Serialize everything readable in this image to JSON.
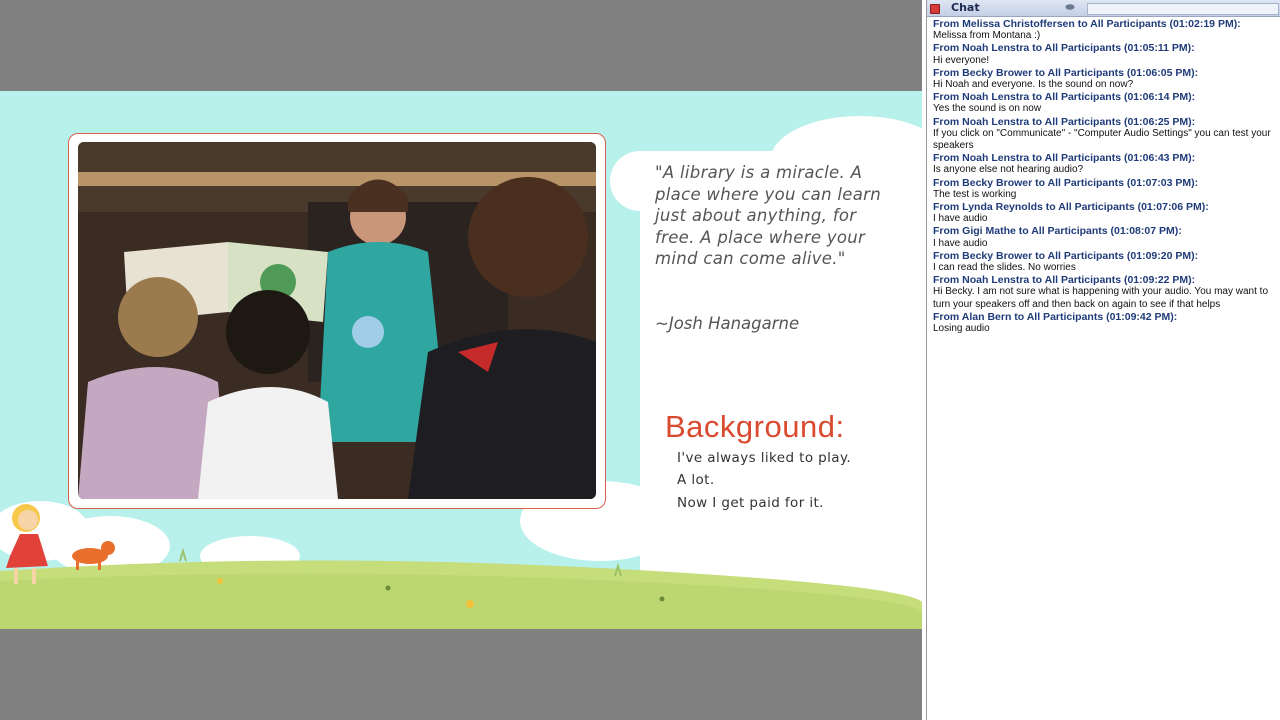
{
  "slide": {
    "quote": "\"A library is a miracle. A place where you can learn just about anything, for free. A place where your mind can come alive.\"",
    "quote_author": "~Josh Hanagarne",
    "background_heading": "Background:",
    "background_lines": [
      "I've always liked to play.",
      "A lot.",
      "Now I get paid for it."
    ]
  },
  "chat": {
    "title": "Chat",
    "messages": [
      {
        "header": "From Melissa Christoffersen to All Participants (01:02:19 PM):",
        "text": "Melissa from Montana :)"
      },
      {
        "header": "From Noah Lenstra to All Participants (01:05:11 PM):",
        "text": "Hi everyone!"
      },
      {
        "header": "From Becky Brower to All Participants (01:06:05 PM):",
        "text": "Hi Noah and everyone. Is the sound on now?"
      },
      {
        "header": "From Noah Lenstra to All Participants (01:06:14 PM):",
        "text": "Yes the sound is on now"
      },
      {
        "header": "From Noah Lenstra to All Participants (01:06:25 PM):",
        "text": "If you click on \"Communicate\" - \"Computer Audio Settings\" you can test your speakers"
      },
      {
        "header": "From Noah Lenstra to All Participants (01:06:43 PM):",
        "text": "Is anyone else not hearing audio?"
      },
      {
        "header": "From Becky Brower to All Participants (01:07:03 PM):",
        "text": "The test is working"
      },
      {
        "header": "From Lynda Reynolds to All Participants (01:07:06 PM):",
        "text": "I have audio"
      },
      {
        "header": "From Gigi Mathe to All Participants (01:08:07 PM):",
        "text": "I have audio"
      },
      {
        "header": "From Becky Brower to All Participants (01:09:20 PM):",
        "text": "I can read the slides. No worries"
      },
      {
        "header": "From Noah Lenstra to All Participants (01:09:22 PM):",
        "text": "Hi Becky. I am not sure what is happening with your audio. You may want to turn your speakers off and then back on again to see if that helps"
      },
      {
        "header": "From Alan Bern to All Participants (01:09:42 PM):",
        "text": "Losing audio"
      }
    ]
  },
  "colors": {
    "accent_red": "#d94a2e",
    "chat_header_blue": "#1f3b7a",
    "slide_sky": "#b8f0ec",
    "stage_gray": "#808080"
  }
}
